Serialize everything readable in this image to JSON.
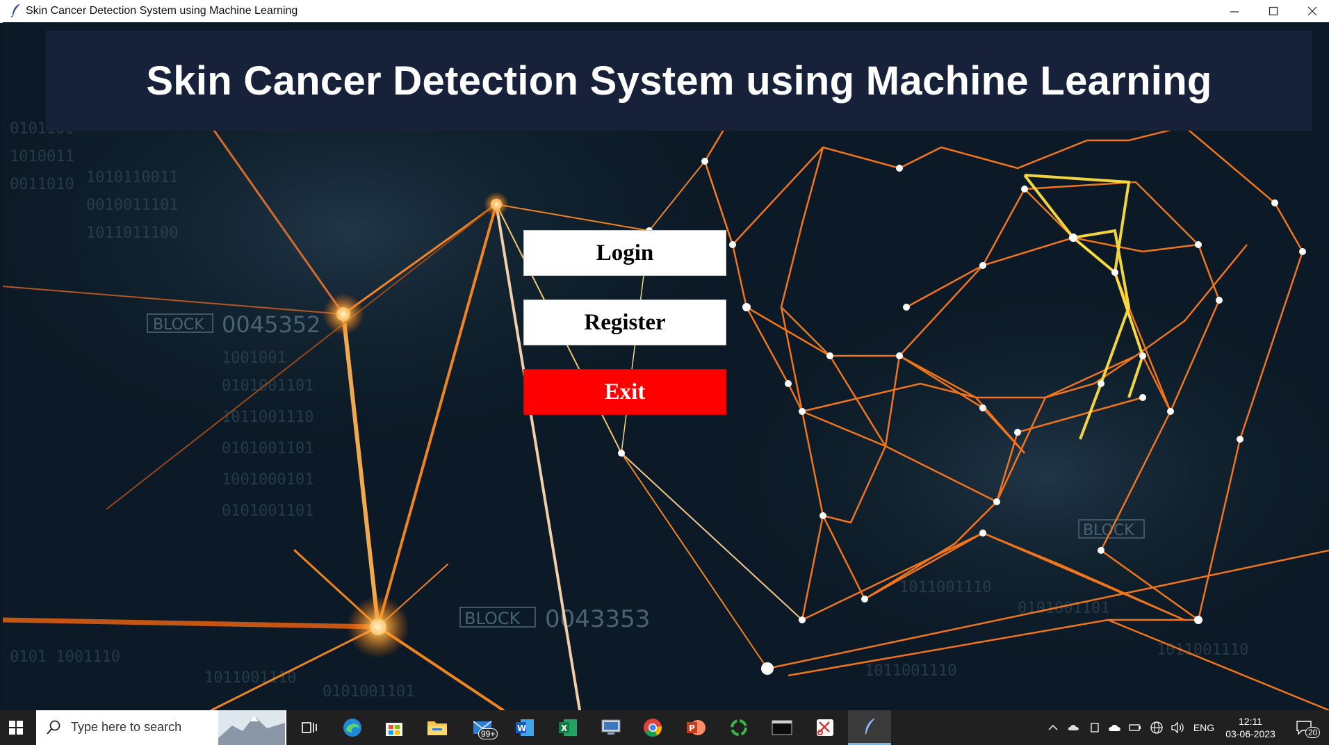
{
  "window": {
    "title": "Skin Cancer Detection System using Machine Learning"
  },
  "header": {
    "heading": "Skin Cancer Detection System using Machine Learning"
  },
  "menu": {
    "login_label": "Login",
    "register_label": "Register",
    "exit_label": "Exit"
  },
  "background_text": {
    "block1_label": "BLOCK",
    "block1_number": "0045352",
    "block2_label": "BLOCK",
    "block2_number": "0043353",
    "block3_label": "BLOCK"
  },
  "taskbar": {
    "search_placeholder": "Type here to search",
    "mail_badge": "99+",
    "language": "ENG",
    "time": "12:11",
    "date": "03-06-2023",
    "notification_count": "20"
  },
  "colors": {
    "banner": "#17213a",
    "exit_button": "#ff0000",
    "button": "#ffffff",
    "taskbar": "#202020"
  }
}
